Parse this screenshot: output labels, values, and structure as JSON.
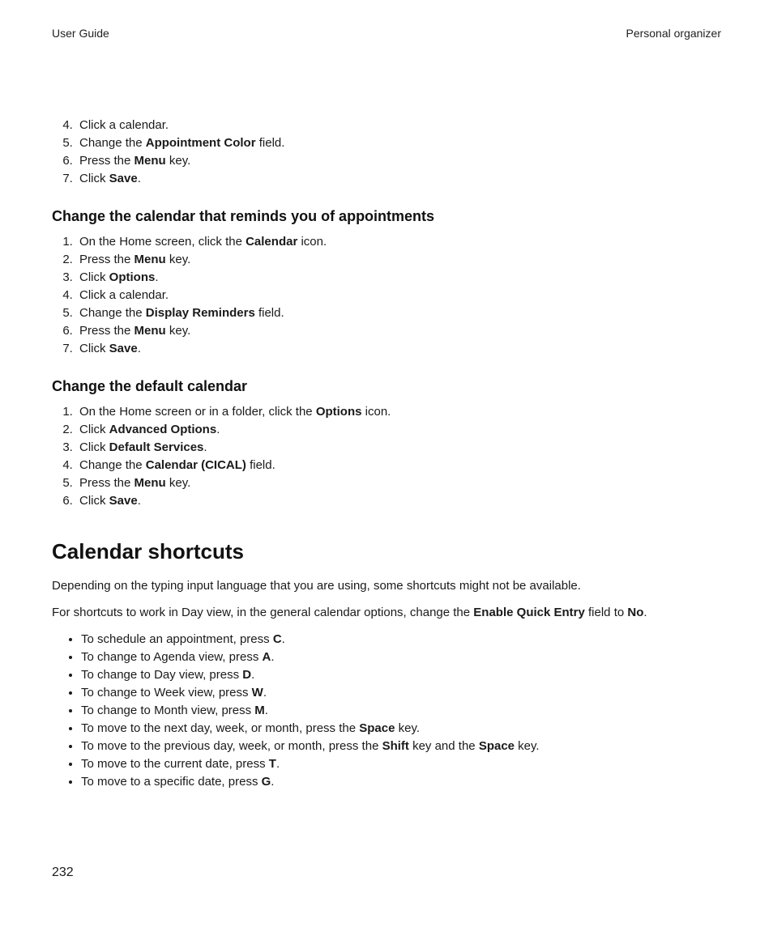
{
  "header": {
    "left": "User Guide",
    "right": "Personal organizer"
  },
  "topSteps": {
    "start": 4,
    "items": [
      {
        "segments": [
          {
            "t": "Click a calendar."
          }
        ]
      },
      {
        "segments": [
          {
            "t": "Change the "
          },
          {
            "t": "Appointment Color",
            "b": true
          },
          {
            "t": " field."
          }
        ]
      },
      {
        "segments": [
          {
            "t": "Press the "
          },
          {
            "t": "Menu",
            "b": true
          },
          {
            "t": " key."
          }
        ]
      },
      {
        "segments": [
          {
            "t": "Click "
          },
          {
            "t": "Save",
            "b": true
          },
          {
            "t": "."
          }
        ]
      }
    ]
  },
  "sub1": {
    "title": "Change the calendar that reminds you of appointments",
    "steps": [
      {
        "segments": [
          {
            "t": "On the Home screen, click the "
          },
          {
            "t": "Calendar",
            "b": true
          },
          {
            "t": " icon."
          }
        ]
      },
      {
        "segments": [
          {
            "t": "Press the "
          },
          {
            "t": "Menu",
            "b": true
          },
          {
            "t": " key."
          }
        ]
      },
      {
        "segments": [
          {
            "t": "Click "
          },
          {
            "t": "Options",
            "b": true
          },
          {
            "t": "."
          }
        ]
      },
      {
        "segments": [
          {
            "t": "Click a calendar."
          }
        ]
      },
      {
        "segments": [
          {
            "t": "Change the "
          },
          {
            "t": "Display Reminders",
            "b": true
          },
          {
            "t": " field."
          }
        ]
      },
      {
        "segments": [
          {
            "t": "Press the "
          },
          {
            "t": "Menu",
            "b": true
          },
          {
            "t": " key."
          }
        ]
      },
      {
        "segments": [
          {
            "t": "Click "
          },
          {
            "t": "Save",
            "b": true
          },
          {
            "t": "."
          }
        ]
      }
    ]
  },
  "sub2": {
    "title": "Change the default calendar",
    "steps": [
      {
        "segments": [
          {
            "t": "On the Home screen or in a folder, click the "
          },
          {
            "t": "Options",
            "b": true
          },
          {
            "t": " icon."
          }
        ]
      },
      {
        "segments": [
          {
            "t": "Click "
          },
          {
            "t": "Advanced Options",
            "b": true
          },
          {
            "t": "."
          }
        ]
      },
      {
        "segments": [
          {
            "t": "Click "
          },
          {
            "t": "Default Services",
            "b": true
          },
          {
            "t": "."
          }
        ]
      },
      {
        "segments": [
          {
            "t": "Change the "
          },
          {
            "t": "Calendar (CICAL)",
            "b": true
          },
          {
            "t": " field."
          }
        ]
      },
      {
        "segments": [
          {
            "t": "Press the "
          },
          {
            "t": "Menu",
            "b": true
          },
          {
            "t": " key."
          }
        ]
      },
      {
        "segments": [
          {
            "t": "Click "
          },
          {
            "t": "Save",
            "b": true
          },
          {
            "t": "."
          }
        ]
      }
    ]
  },
  "section": {
    "title": "Calendar shortcuts",
    "para1": [
      {
        "t": "Depending on the typing input language that you are using, some shortcuts might not be available."
      }
    ],
    "para2": [
      {
        "t": "For shortcuts to work in Day view, in the general calendar options, change the "
      },
      {
        "t": "Enable Quick Entry",
        "b": true
      },
      {
        "t": " field to "
      },
      {
        "t": "No",
        "b": true
      },
      {
        "t": "."
      }
    ],
    "bullets": [
      {
        "segments": [
          {
            "t": "To schedule an appointment, press "
          },
          {
            "t": "C",
            "b": true
          },
          {
            "t": "."
          }
        ]
      },
      {
        "segments": [
          {
            "t": "To change to Agenda view, press "
          },
          {
            "t": "A",
            "b": true
          },
          {
            "t": "."
          }
        ]
      },
      {
        "segments": [
          {
            "t": "To change to Day view, press "
          },
          {
            "t": "D",
            "b": true
          },
          {
            "t": "."
          }
        ]
      },
      {
        "segments": [
          {
            "t": "To change to Week view, press "
          },
          {
            "t": "W",
            "b": true
          },
          {
            "t": "."
          }
        ]
      },
      {
        "segments": [
          {
            "t": "To change to Month view, press "
          },
          {
            "t": "M",
            "b": true
          },
          {
            "t": "."
          }
        ]
      },
      {
        "segments": [
          {
            "t": "To move to the next day, week, or month, press the "
          },
          {
            "t": "Space",
            "b": true
          },
          {
            "t": " key."
          }
        ]
      },
      {
        "segments": [
          {
            "t": "To move to the previous day, week, or month, press the "
          },
          {
            "t": "Shift",
            "b": true
          },
          {
            "t": " key and the "
          },
          {
            "t": "Space",
            "b": true
          },
          {
            "t": " key."
          }
        ]
      },
      {
        "segments": [
          {
            "t": "To move to the current date, press "
          },
          {
            "t": "T",
            "b": true
          },
          {
            "t": "."
          }
        ]
      },
      {
        "segments": [
          {
            "t": "To move to a specific date, press "
          },
          {
            "t": "G",
            "b": true
          },
          {
            "t": "."
          }
        ]
      }
    ]
  },
  "pageNumber": "232"
}
